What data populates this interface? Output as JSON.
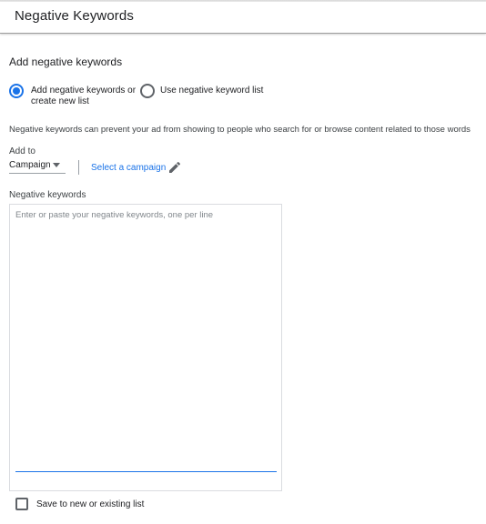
{
  "header": {
    "title": "Negative Keywords"
  },
  "section": {
    "title": "Add negative keywords"
  },
  "options": {
    "option_new_line1": "Add negative keywords or",
    "option_new_line2": "create new list",
    "option_list": "Use negative keyword list",
    "selected": "new"
  },
  "description": "Negative keywords can prevent your ad from showing to people who search for or browse content related to those words",
  "add_to": {
    "label": "Add to",
    "selected": "Campaign",
    "link": "Select a campaign"
  },
  "keywords": {
    "label": "Negative keywords",
    "placeholder": "Enter or paste your negative keywords, one per line",
    "value": ""
  },
  "save": {
    "label": "Save to new or existing list",
    "checked": false
  },
  "colors": {
    "accent": "#1a73e8",
    "text": "#202124",
    "muted": "#80868b"
  }
}
